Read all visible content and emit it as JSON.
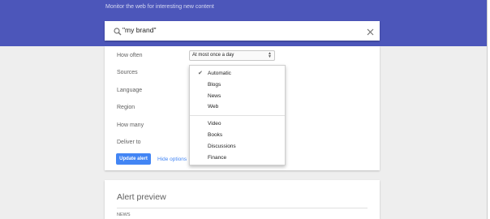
{
  "header": {
    "tagline": "Monitor the web for interesting new content"
  },
  "search": {
    "value": "\"my brand\"",
    "icon": "search-icon",
    "clear_icon": "close-icon"
  },
  "options": {
    "how_often_label": "How often",
    "how_often_value": "At most once a day",
    "sources_label": "Sources",
    "language_label": "Language",
    "region_label": "Region",
    "how_many_label": "How many",
    "deliver_to_label": "Deliver to",
    "update_button": "Update alert",
    "hide_options": "Hide options"
  },
  "sources_dropdown": {
    "selected": "Automatic",
    "items": [
      "Automatic",
      "Blogs",
      "News",
      "Web",
      "Video",
      "Books",
      "Discussions",
      "Finance"
    ]
  },
  "preview": {
    "title": "Alert preview",
    "section": "NEWS"
  },
  "colors": {
    "header_bg": "#4c56ba",
    "accent": "#4285f4"
  }
}
